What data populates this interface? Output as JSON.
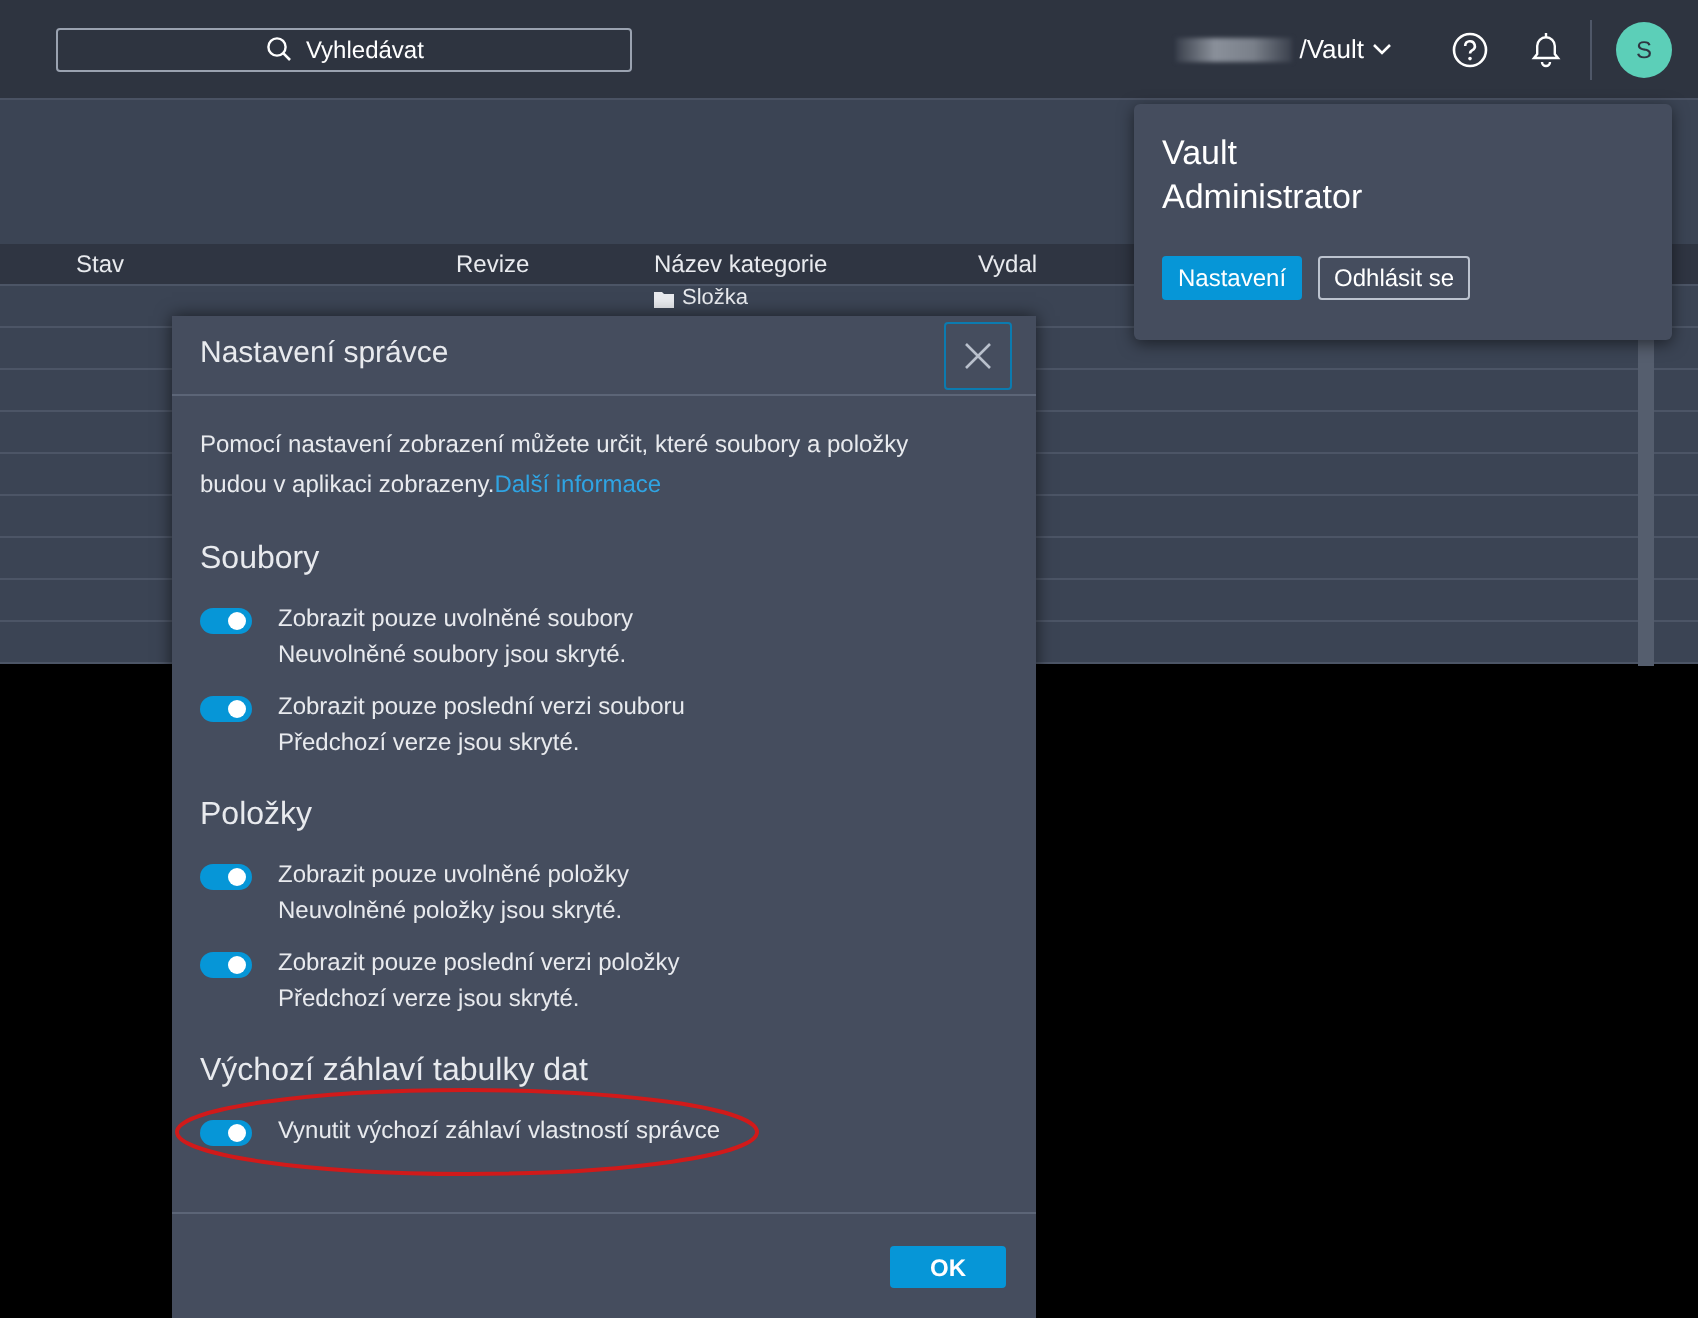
{
  "topbar": {
    "search": {
      "placeholder": "Vyhledávat"
    },
    "vault": {
      "label": "/Vault",
      "redacted": true
    },
    "avatar": "S"
  },
  "table": {
    "columns": [
      "Stav",
      "Revize",
      "Název kategorie",
      "Vydal"
    ],
    "rows": [
      {
        "cells": [
          "",
          "",
          "Složka",
          ""
        ]
      }
    ]
  },
  "user_menu": {
    "name": "Vault Administrator",
    "buttons": [
      {
        "label": "Nastavení",
        "primary": true
      },
      {
        "label": "Odhlásit se",
        "primary": false
      }
    ]
  },
  "dialog": {
    "title": "Nastavení správce",
    "intro": "Pomocí nastavení zobrazení můžete určit, které soubory a položky budou v aplikaci zobrazeny.",
    "link": "Další informace",
    "sections": [
      {
        "title": "Soubory",
        "options": [
          {
            "label": "Zobrazit pouze uvolněné soubory",
            "hint": "Neuvolněné soubory jsou skryté.",
            "on": true,
            "highlighted": false
          },
          {
            "label": "Zobrazit pouze poslední verzi souboru",
            "hint": "Předchozí verze jsou skryté.",
            "on": true,
            "highlighted": false
          }
        ]
      },
      {
        "title": "Položky",
        "options": [
          {
            "label": "Zobrazit pouze uvolněné položky",
            "hint": "Neuvolněné položky jsou skryté.",
            "on": true,
            "highlighted": false
          },
          {
            "label": "Zobrazit pouze poslední verzi položky",
            "hint": "Předchozí verze jsou skryté.",
            "on": true,
            "highlighted": false
          }
        ]
      },
      {
        "title": "Výchozí záhlaví tabulky dat",
        "options": [
          {
            "label": "Vynutit výchozí záhlaví vlastností správce",
            "on": true,
            "highlighted": true
          }
        ]
      }
    ],
    "ok": "OK"
  }
}
